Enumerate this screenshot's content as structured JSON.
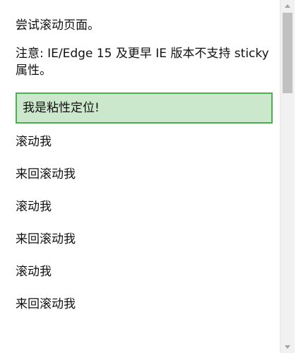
{
  "page": {
    "intro": "尝试滚动页面。",
    "note": "注意: IE/Edge 15 及更早 IE 版本不支持 sticky 属性。",
    "sticky_label": "我是粘性定位!",
    "scroll_lines": [
      "滚动我",
      "来回滚动我",
      "滚动我",
      "来回滚动我",
      "滚动我",
      "来回滚动我"
    ]
  },
  "colors": {
    "sticky_background": "#cce8cc",
    "sticky_border": "#4caf50"
  }
}
